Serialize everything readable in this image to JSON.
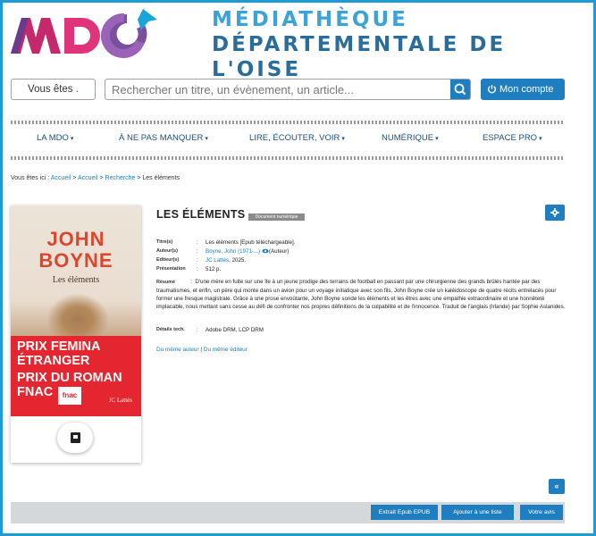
{
  "header": {
    "logo_text": "MDO",
    "title_line1": "MÉDIATHÈQUE",
    "title_line2": "DÉPARTEMENTALE DE L'OISE"
  },
  "toolbar": {
    "vous_etes_label": "Vous êtes .",
    "search_placeholder": "Rechercher un titre, un évènement, un article...",
    "account_label": "Mon compte"
  },
  "nav": {
    "items": [
      {
        "label": "LA MDO"
      },
      {
        "label": "À NE PAS MANQUER"
      },
      {
        "label": "LIRE, ÉCOUTER, VOIR"
      },
      {
        "label": "NUMÉRIQUE"
      },
      {
        "label": "ESPACE PRO"
      }
    ],
    "caret": "▾"
  },
  "breadcrumb": {
    "prefix": "Vous êtes ici :",
    "links": [
      "Accueil",
      "Accueil",
      "Recherche"
    ],
    "separator": ">",
    "current": "Les éléments"
  },
  "cover": {
    "author_line1": "JOHN",
    "author_line2": "BOYNE",
    "title": "Les éléments",
    "prize_lines": [
      "PRIX FEMINA",
      "ÉTRANGER",
      "PRIX DU ROMAN",
      "FNAC"
    ],
    "fnac_logo": "fnac",
    "publisher": "JC Lattès"
  },
  "notice": {
    "title": "LES ÉLÉMENTS",
    "badge": "Document numérique",
    "fields": {
      "titre": {
        "label": "Titre(s)",
        "value": "Les éléments [Epub téléchargeable]."
      },
      "auteur": {
        "label": "Auteur(s)",
        "link": "Boyne, John (1971-...)",
        "suffix": "(Auteur)"
      },
      "editeur": {
        "label": "Editeur(s)",
        "link": "JC Lattès",
        "suffix": ", 2025."
      },
      "presentation": {
        "label": "Présentation",
        "value": "512 p."
      },
      "resume": {
        "label": "Résumé",
        "value": "D'une mère en fuite sur une île à un jeune prodige des terrains de football en passant par une chirurgienne des grands brûlés hantée par des traumatismes, et enfin, un père qui monte dans un avion pour un voyage initiatique avec son fils, John Boyne crée un kaléidoscope de quatre récits entrelacés pour former une fresque magistrale.  Grâce à une prose envoûtante, John Boyne sonde les éléments et les êtres avec une empathie extraordinaire et une honnêteté implacable, nous mettant sans cesse au défi de confronter nos propres définitions de la culpabilité et de l'innocence.   Traduit de l'anglais (Irlande) par Sophie Aslanides."
      },
      "details": {
        "label": "Détails tech.",
        "value": "Adobe DRM, LCP DRM"
      }
    },
    "colon": ":",
    "link_same_author": "Du même auteur",
    "link_sep": "|",
    "link_same_publisher": "Du même éditeur"
  },
  "footer": {
    "collapse": "«",
    "extract_label": "Extrait Epub EPUB",
    "add_list_label": "Ajouter à une liste",
    "review_label": "Votre avis"
  },
  "colors": {
    "accent": "#1f7ebf",
    "frame": "#1f9ad6",
    "title_blue": "#2a8fc9",
    "prize_red": "#e3262f"
  }
}
